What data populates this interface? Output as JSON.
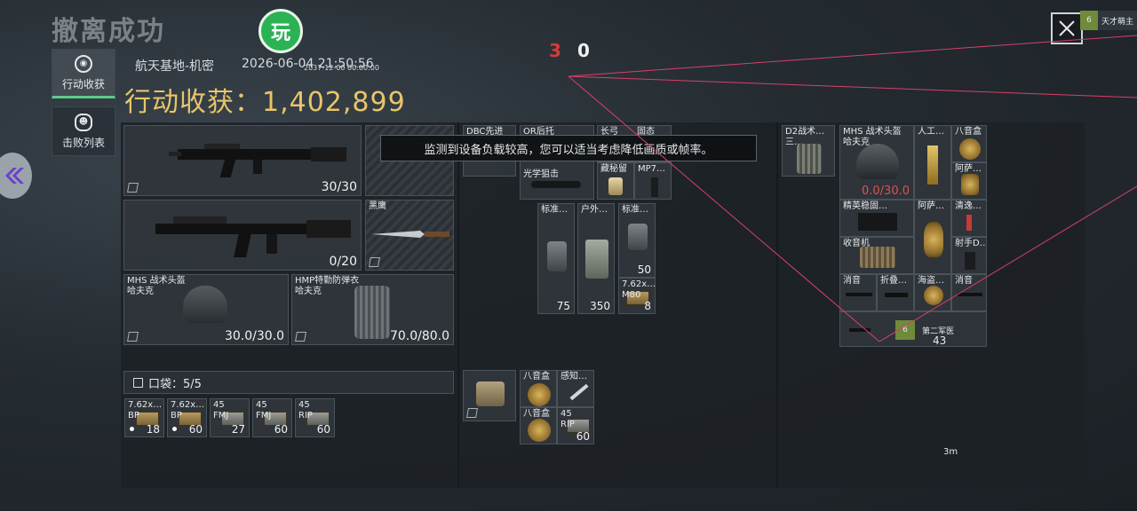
{
  "header": {
    "title": "撤离成功",
    "logo_text": "玩",
    "location": "航天基地-机密",
    "datetime": "2026-06-04 21:50:56",
    "overlay_time": "2037-12-00 00:00:00",
    "earnings": "行动收获：1,402,899",
    "score_red": "3",
    "score_white": "0",
    "banner_level": "6",
    "banner_text": "天才萌主"
  },
  "tabs": [
    {
      "label": "行动收获"
    },
    {
      "label": "击败列表"
    }
  ],
  "toast": "监测到设备负载较高，您可以适当考虑降低画质或帧率。",
  "equipment": {
    "rifle1_count": "30/30",
    "rifle2_count": "0/20",
    "knife_label": "黑鹰",
    "helmet": {
      "name": "MHS 战术头盔\n哈夫克",
      "value": "30.0/30.0"
    },
    "armor": {
      "name": "HMP特勤防弹衣\n哈夫克",
      "value": "70.0/80.0"
    }
  },
  "pocket": {
    "label": "口袋：5/5",
    "items": [
      {
        "name": "7.62x…\nBP",
        "count": "18"
      },
      {
        "name": "7.62x…\nBP",
        "count": "60"
      },
      {
        "name": "45\nFMJ",
        "count": "27"
      },
      {
        "name": "45\nFMJ",
        "count": "60"
      },
      {
        "name": "45\nRIP",
        "count": "60"
      }
    ]
  },
  "middle": {
    "top_items": [
      {
        "name": "DBC先进"
      },
      {
        "name": "OR后托"
      },
      {
        "name": "长弓"
      },
      {
        "name": "固态"
      }
    ],
    "scope_label": "光学狙击",
    "small_items": [
      {
        "name": "藏秘留"
      },
      {
        "name": "MP7…"
      }
    ],
    "tall_items": [
      {
        "name": "标准…",
        "count": "75"
      },
      {
        "name": "户外…",
        "count": "350"
      },
      {
        "name": "标准…",
        "count": "50"
      }
    ],
    "ammo_item": {
      "name": "7.62x…\nM80",
      "count": "8"
    },
    "bottom_items": [
      {
        "name": "八音盒"
      },
      {
        "name": "感知…"
      },
      {
        "name": "八音盒"
      },
      {
        "name": "45\nRIP",
        "count": "60"
      }
    ]
  },
  "right": {
    "rig": {
      "name": "D2战术…\n三…"
    },
    "helmet": {
      "name": "MHS 战术头盔\n哈夫克",
      "value": "0.0/30.0"
    },
    "grid": [
      {
        "name": "人工…"
      },
      {
        "name": "八音盒"
      },
      {
        "name": "阿萨…"
      },
      {
        "name": "精英稳固…"
      },
      {
        "name": "阿萨…"
      },
      {
        "name": "清逸…"
      },
      {
        "name": "收音机"
      },
      {
        "name": "射手D…"
      },
      {
        "name": "消音"
      },
      {
        "name": "折叠…"
      },
      {
        "name": "海盗…"
      },
      {
        "name": "消音"
      }
    ],
    "tip_level": "6",
    "tip_text": "第二军医",
    "tip_count": "43",
    "range": "3m"
  },
  "colors": {
    "earn": "#e8c56a",
    "accent_green": "#5ec98c",
    "score_red": "#d63a3a",
    "laser": "#d8406a"
  }
}
